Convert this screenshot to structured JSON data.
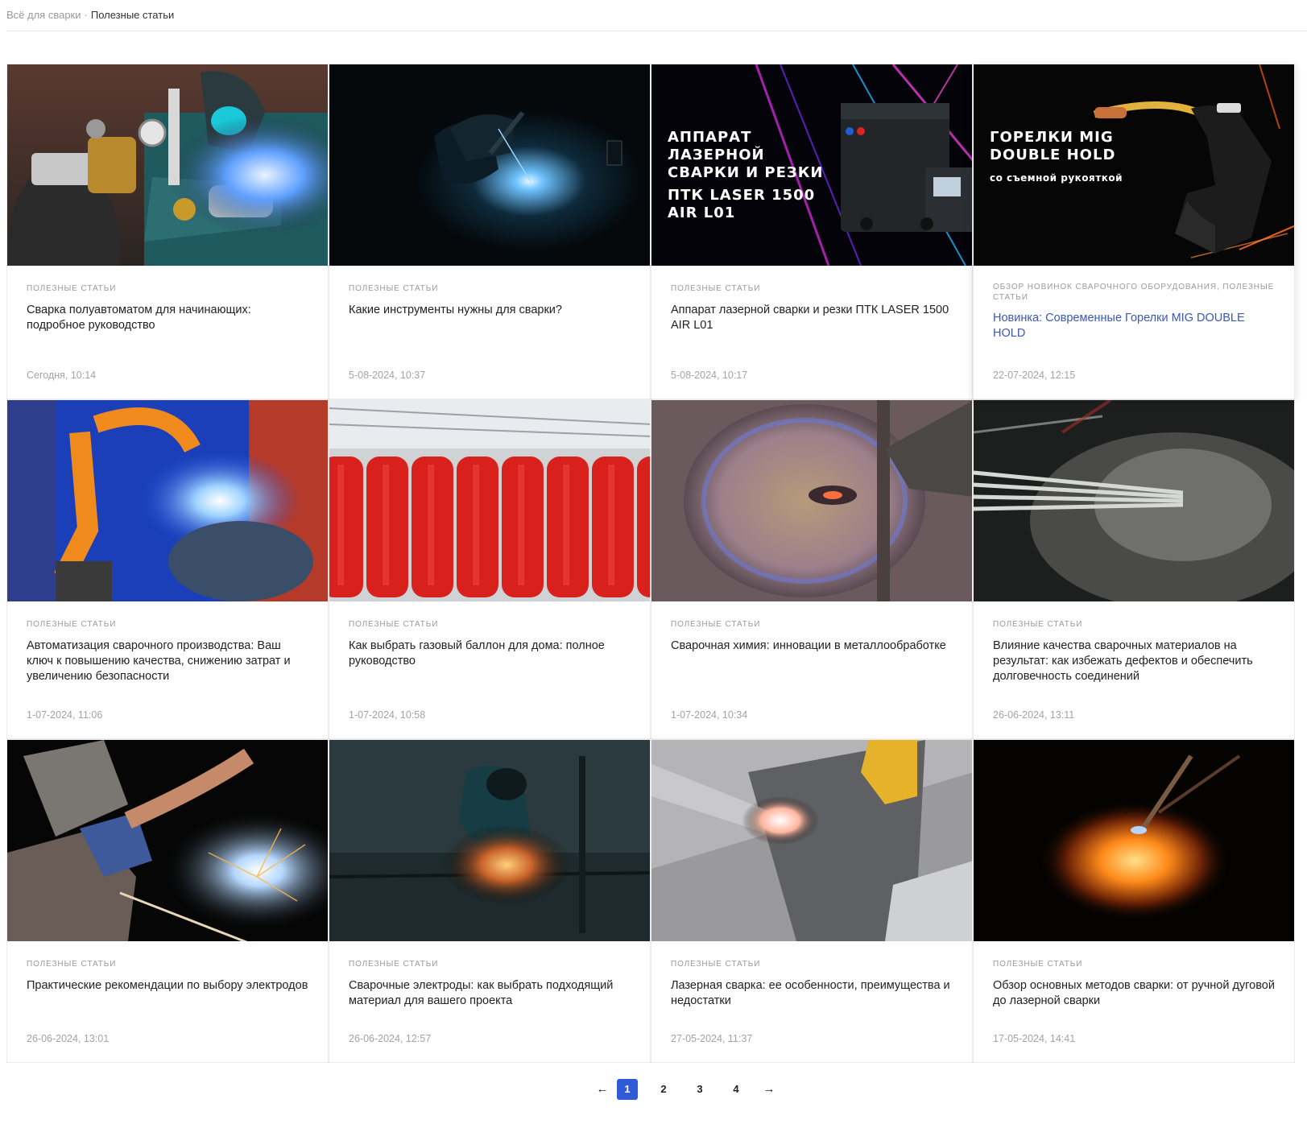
{
  "breadcrumb": {
    "home": "Всё для сварки",
    "separator": "·",
    "current": "Полезные статьи"
  },
  "cards": [
    {
      "category": "ПОЛЕЗНЫЕ СТАТЬИ",
      "title": "Сварка полуавтоматом для начинающих: подробное руководство",
      "date": "Сегодня, 10:14"
    },
    {
      "category": "ПОЛЕЗНЫЕ СТАТЬИ",
      "title": "Какие инструменты нужны для сварки?",
      "date": "5-08-2024, 10:37"
    },
    {
      "category": "ПОЛЕЗНЫЕ СТАТЬИ",
      "title": "Аппарат лазерной сварки и резки ПТК LASER 1500 AIR L01",
      "date": "5-08-2024, 10:17",
      "banner": {
        "line1": "АППАРАТ",
        "line2": "ЛАЗЕРНОЙ",
        "line3": "СВАРКИ И РЕЗКИ",
        "line4": "ПТК LASER 1500",
        "line5": "AIR L01"
      }
    },
    {
      "category": "ОБЗОР НОВИНОК СВАРОЧНОГО ОБОРУДОВАНИЯ, ПОЛЕЗНЫЕ СТАТЬИ",
      "title": "Новинка: Современные Горелки MIG DOUBLE HOLD",
      "date": "22-07-2024, 12:15",
      "banner": {
        "line1": "ГОРЕЛКИ MIG",
        "line2": "DOUBLE HOLD",
        "line3": "со съемной рукояткой"
      }
    },
    {
      "category": "ПОЛЕЗНЫЕ СТАТЬИ",
      "title": "Автоматизация сварочного производства: Ваш ключ к повышению качества, снижению затрат и увеличению безопасности",
      "date": "1-07-2024, 11:06"
    },
    {
      "category": "ПОЛЕЗНЫЕ СТАТЬИ",
      "title": "Как выбрать газовый баллон для дома: полное руководство",
      "date": "1-07-2024, 10:58"
    },
    {
      "category": "ПОЛЕЗНЫЕ СТАТЬИ",
      "title": "Сварочная химия: инновации в металлообработке",
      "date": "1-07-2024, 10:34"
    },
    {
      "category": "ПОЛЕЗНЫЕ СТАТЬИ",
      "title": "Влияние качества сварочных материалов на результат: как избежать дефектов и обеспечить долговечность соединений",
      "date": "26-06-2024, 13:11"
    },
    {
      "category": "ПОЛЕЗНЫЕ СТАТЬИ",
      "title": "Практические рекомендации по выбору электродов",
      "date": "26-06-2024, 13:01"
    },
    {
      "category": "ПОЛЕЗНЫЕ СТАТЬИ",
      "title": "Сварочные электроды: как выбрать подходящий материал для вашего проекта",
      "date": "26-06-2024, 12:57"
    },
    {
      "category": "ПОЛЕЗНЫЕ СТАТЬИ",
      "title": "Лазерная сварка: ее особенности, преимущества и недостатки",
      "date": "27-05-2024, 11:37"
    },
    {
      "category": "ПОЛЕЗНЫЕ СТАТЬИ",
      "title": "Обзор основных методов сварки: от ручной дуговой до лазерной сварки",
      "date": "17-05-2024, 14:41"
    }
  ],
  "pagination": {
    "prev": "←",
    "pages": [
      "1",
      "2",
      "3",
      "4"
    ],
    "current": "1",
    "next": "→"
  },
  "colors": {
    "accent": "#2f5bd6",
    "highlight_title": "#3b57b8",
    "category": "#9a9a9a",
    "date": "#a3a3a3"
  }
}
